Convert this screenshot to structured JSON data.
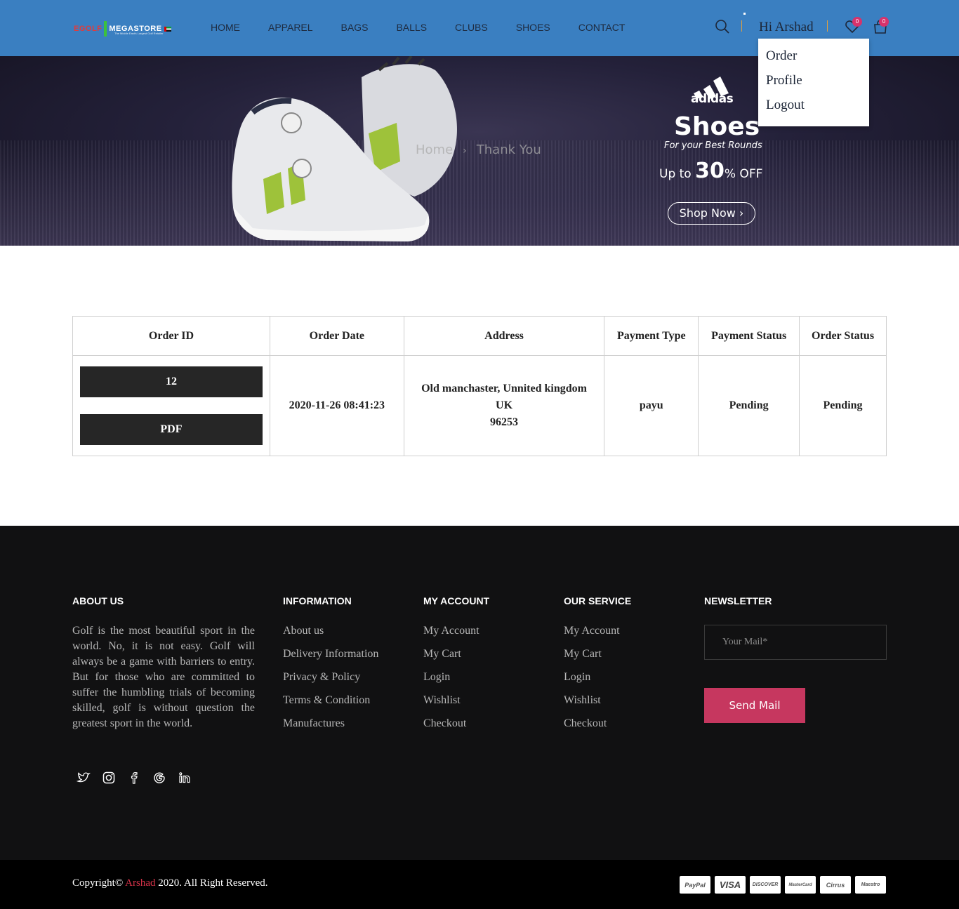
{
  "brand": {
    "logo_left": "EGOLF",
    "logo_right": "MEGASTORE",
    "tagline": "The Middle East's Largest Golf Retailer"
  },
  "nav": [
    "HOME",
    "APPAREL",
    "BAGS",
    "BALLS",
    "CLUBS",
    "SHOES",
    "CONTACT"
  ],
  "user": {
    "greeting": "Hi Arshad",
    "wishlist_count": "0",
    "cart_count": "0"
  },
  "user_menu": [
    "Order",
    "Profile",
    "Logout"
  ],
  "banner": {
    "breadcrumb": [
      "Home",
      "Thank You"
    ],
    "brand": "adidas",
    "title": "Shoes",
    "subtitle": "For your Best Rounds",
    "offer_prefix": "Up to",
    "offer_value": "30",
    "offer_suffix": "% OFF",
    "cta": "Shop Now"
  },
  "orders": {
    "headers": [
      "Order ID",
      "Order Date",
      "Address",
      "Payment Type",
      "Payment Status",
      "Order Status"
    ],
    "rows": [
      {
        "id": "12",
        "pdf": "PDF",
        "date": "2020-11-26 08:41:23",
        "address": [
          "Old manchaster, Unnited kingdom",
          "UK",
          "96253"
        ],
        "payment_type": "payu",
        "payment_status": "Pending",
        "order_status": "Pending"
      }
    ]
  },
  "footer": {
    "about": {
      "title": "ABOUT US",
      "text": "Golf is the most beautiful sport in the world. No, it is not easy. Golf will always be a game with barriers to entry. But for those who are committed to suffer the humbling trials of becoming skilled, golf is without question the greatest sport in the world."
    },
    "information": {
      "title": "INFORMATION",
      "links": [
        "About us",
        "Delivery Information",
        "Privacy & Policy",
        "Terms & Condition",
        "Manufactures"
      ]
    },
    "my_account": {
      "title": "MY ACCOUNT",
      "links": [
        "My Account",
        "My Cart",
        "Login",
        "Wishlist",
        "Checkout"
      ]
    },
    "our_service": {
      "title": "OUR SERVICE",
      "links": [
        "My Account",
        "My Cart",
        "Login",
        "Wishlist",
        "Checkout"
      ]
    },
    "newsletter": {
      "title": "NEWSLETTER",
      "placeholder": "Your Mail*",
      "button": "Send Mail"
    },
    "social_icons": [
      "twitter-icon",
      "instagram-icon",
      "facebook-icon",
      "google-icon",
      "linkedin-icon"
    ],
    "copyright_prefix": "Copyright©",
    "copyright_name": "Arshad",
    "copyright_suffix": "2020. All Right Reserved.",
    "payments": [
      "PayPal",
      "VISA",
      "DISCOVER",
      "MasterCard",
      "Cirrus",
      "Maestro"
    ]
  },
  "colors": {
    "header": "#3a7fc1",
    "accent": "#c6375f",
    "badge": "#d6336c",
    "footer": "#111112"
  }
}
